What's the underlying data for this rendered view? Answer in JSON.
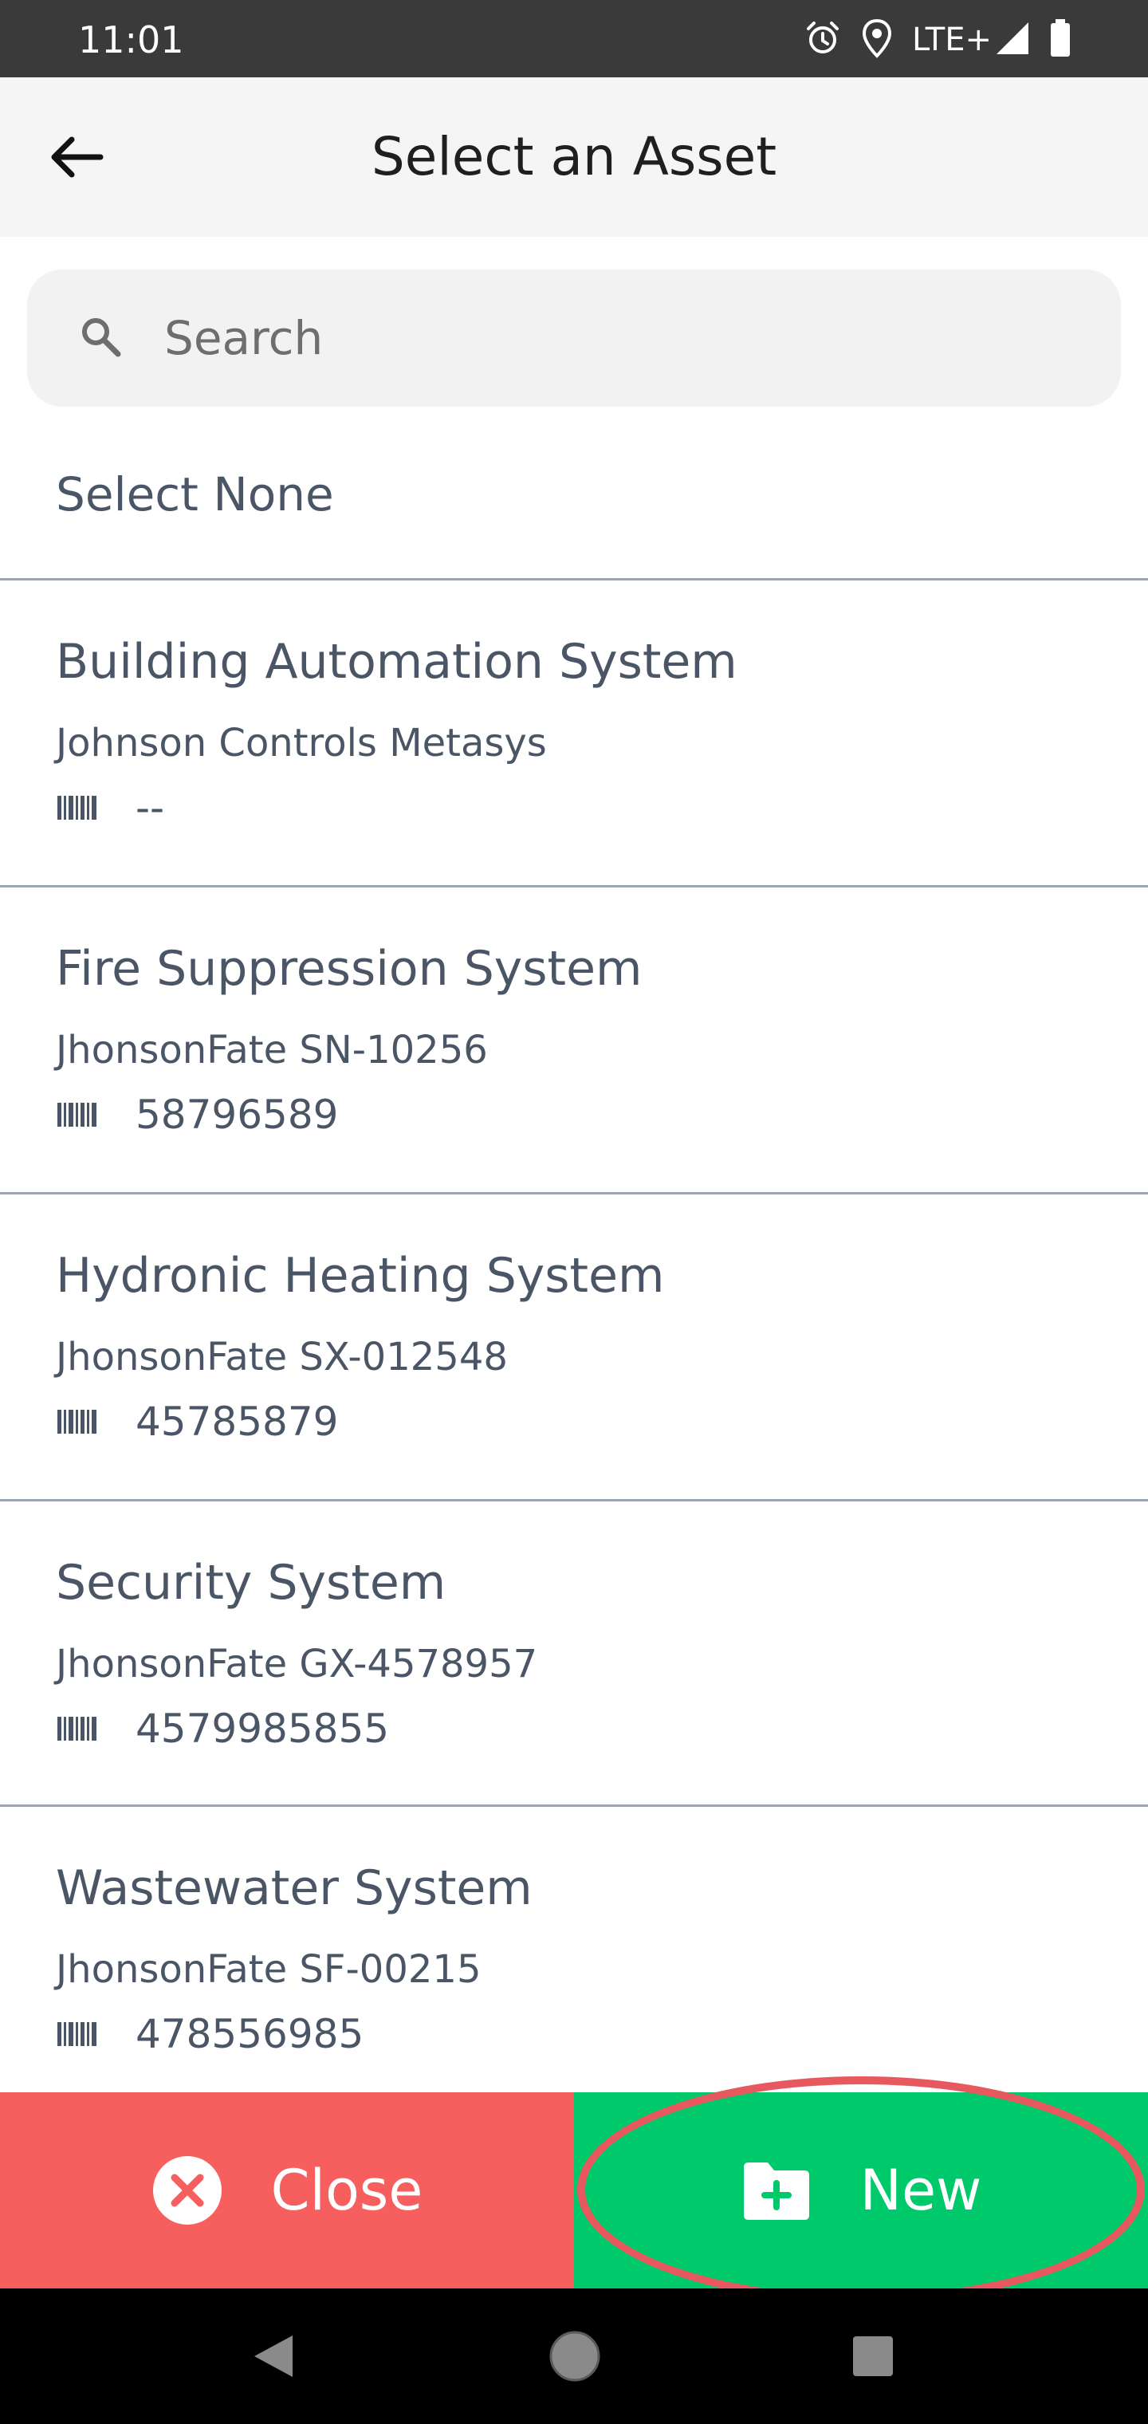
{
  "status_bar": {
    "time": "11:01",
    "network": "LTE+",
    "icons": [
      "alarm-icon",
      "location-icon",
      "signal-icon",
      "battery-icon"
    ]
  },
  "header": {
    "title": "Select an Asset",
    "back_icon": "arrow-left-icon"
  },
  "search": {
    "placeholder": "Search",
    "value": ""
  },
  "select_none_label": "Select None",
  "assets": [
    {
      "name": "Building Automation System",
      "model": "Johnson Controls Metasys",
      "serial": "--"
    },
    {
      "name": "Fire Suppression System",
      "model": "JhonsonFate SN-10256",
      "serial": "58796589"
    },
    {
      "name": "Hydronic Heating System",
      "model": "JhonsonFate SX-012548",
      "serial": "45785879"
    },
    {
      "name": "Security System",
      "model": "JhonsonFate GX-4578957",
      "serial": "4579985855"
    },
    {
      "name": "Wastewater System",
      "model": "JhonsonFate SF-00215",
      "serial": "478556985"
    }
  ],
  "actions": {
    "close_label": "Close",
    "new_label": "New"
  },
  "colors": {
    "close_bg": "#f75e5e",
    "new_bg": "#00c96b",
    "highlight": "#e8595f",
    "text": "#4a5565"
  }
}
